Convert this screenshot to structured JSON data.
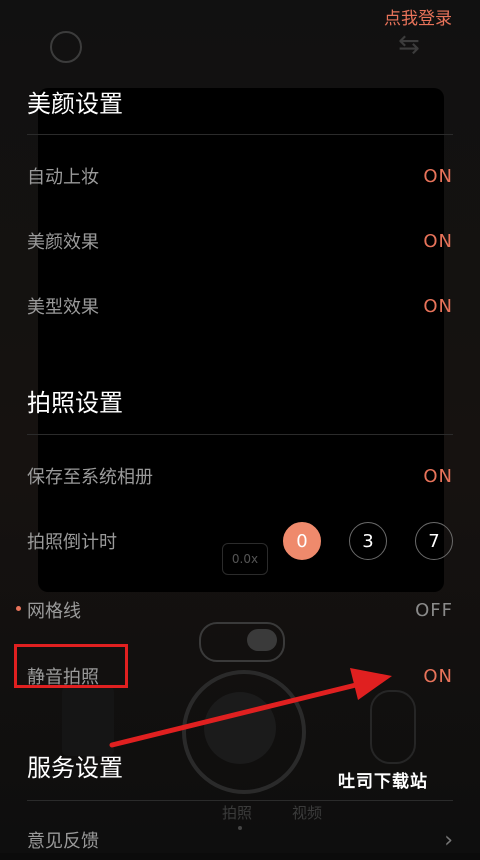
{
  "header": {
    "login_link": "点我登录"
  },
  "background": {
    "zoom": "0.0x",
    "modes": [
      "拍照",
      "视频"
    ]
  },
  "beauty": {
    "title": "美颜设置",
    "items": [
      {
        "label": "自动上妆",
        "value": "ON"
      },
      {
        "label": "美颜效果",
        "value": "ON"
      },
      {
        "label": "美型效果",
        "value": "ON"
      }
    ]
  },
  "photo": {
    "title": "拍照设置",
    "save_album": {
      "label": "保存至系统相册",
      "value": "ON"
    },
    "timer": {
      "label": "拍照倒计时",
      "options": [
        "0",
        "3",
        "7"
      ],
      "selected": "0"
    },
    "grid": {
      "label": "网格线",
      "value": "OFF"
    },
    "mute": {
      "label": "静音拍照",
      "value": "ON"
    }
  },
  "service": {
    "title": "服务设置",
    "feedback": {
      "label": "意见反馈"
    }
  },
  "annotation": {
    "watermark": "吐司下载站"
  },
  "colors": {
    "accent": "#e8735a",
    "highlight": "#e02020"
  },
  "icons": {
    "chevron": "chevron-right-icon",
    "face": "face-icon",
    "swap": "swap-icon"
  }
}
